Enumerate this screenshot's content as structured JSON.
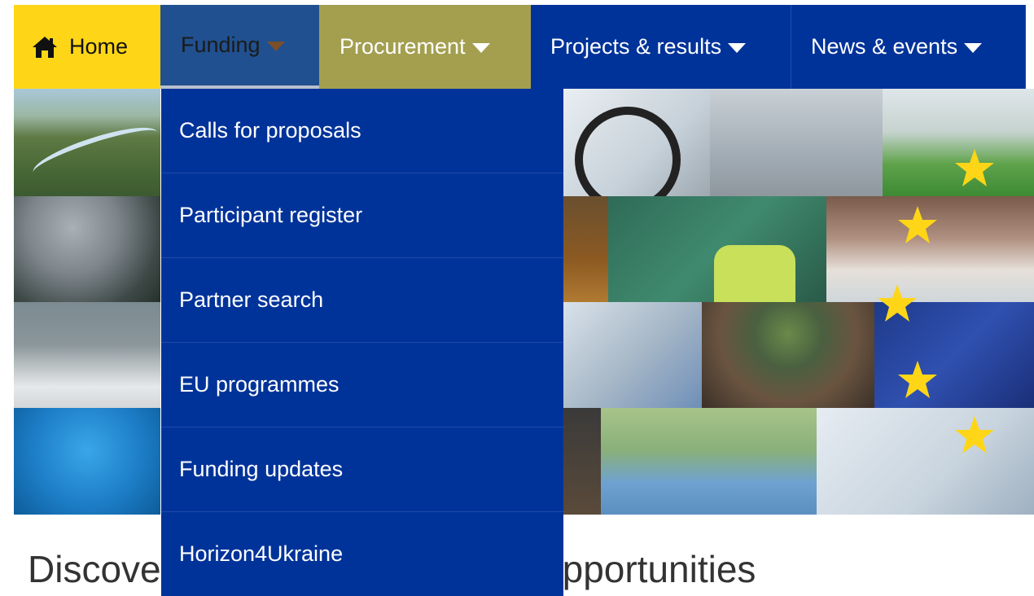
{
  "nav": {
    "home": "Home",
    "funding": "Funding",
    "procurement": "Procurement",
    "projects": "Projects & results",
    "news": "News & events"
  },
  "dropdown": {
    "items": [
      "Calls for proposals",
      "Participant register",
      "Partner search",
      "EU programmes",
      "Funding updates",
      "Horizon4Ukraine"
    ]
  },
  "heading": {
    "left": "Discove",
    "right": "pportunities"
  },
  "colors": {
    "eu_blue": "#003399",
    "eu_yellow": "#ffd617",
    "funding_active": "#20508f",
    "procurement_bg": "#a39f4f"
  },
  "icons": {
    "home": "house-icon",
    "caret": "caret-down-icon",
    "star": "eu-star-icon"
  }
}
